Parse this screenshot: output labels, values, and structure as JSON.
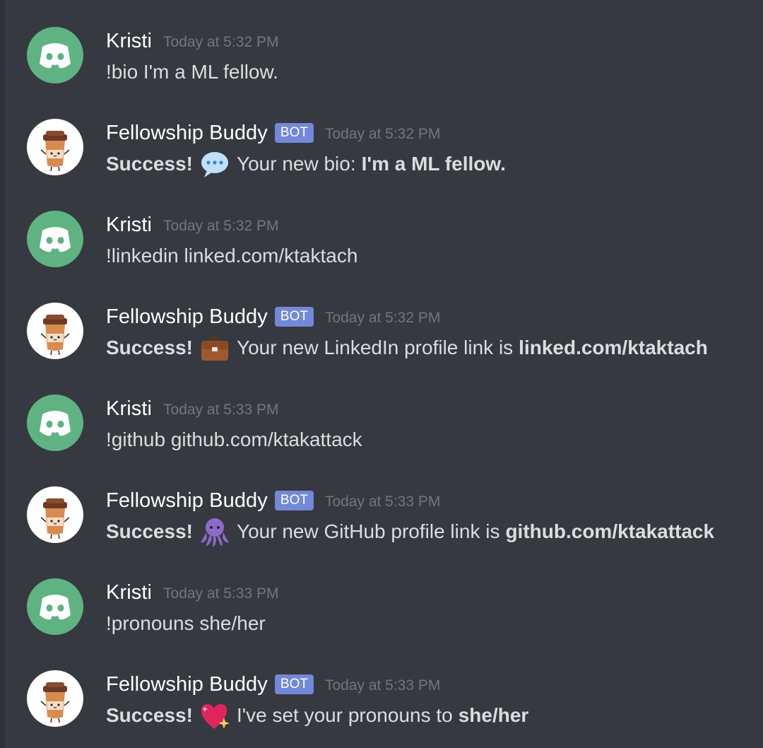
{
  "messages": [
    {
      "author": "Kristi",
      "timestamp": "Today at 5:32 PM",
      "text": "!bio I'm a ML fellow."
    },
    {
      "author": "Fellowship Buddy",
      "bot_tag": "BOT",
      "timestamp": "Today at 5:32 PM",
      "success": "Success!",
      "emoji": "speech-balloon-icon",
      "text": "Your new bio:",
      "value": "I'm a ML fellow."
    },
    {
      "author": "Kristi",
      "timestamp": "Today at 5:32 PM",
      "text": "!linkedin linked.com/ktaktach"
    },
    {
      "author": "Fellowship Buddy",
      "bot_tag": "BOT",
      "timestamp": "Today at 5:32 PM",
      "success": "Success!",
      "emoji": "briefcase-icon",
      "text": "Your new LinkedIn profile link is",
      "value": "linked.com/ktaktach"
    },
    {
      "author": "Kristi",
      "timestamp": "Today at 5:33 PM",
      "text": "!github github.com/ktakattack"
    },
    {
      "author": "Fellowship Buddy",
      "bot_tag": "BOT",
      "timestamp": "Today at 5:33 PM",
      "success": "Success!",
      "emoji": "octopus-icon",
      "text": "Your new GitHub profile link is",
      "value": "github.com/ktakattack"
    },
    {
      "author": "Kristi",
      "timestamp": "Today at 5:33 PM",
      "text": "!pronouns she/her"
    },
    {
      "author": "Fellowship Buddy",
      "bot_tag": "BOT",
      "timestamp": "Today at 5:33 PM",
      "success": "Success!",
      "emoji": "sparkling-heart-icon",
      "text": "I've set your pronouns to",
      "value": "she/her"
    }
  ],
  "colors": {
    "background": "#36393f",
    "username": "#ffffff",
    "timestamp": "#72767d",
    "message_text": "#dcddde",
    "bot_tag": "#7289da",
    "user_avatar": "#5fb383"
  }
}
